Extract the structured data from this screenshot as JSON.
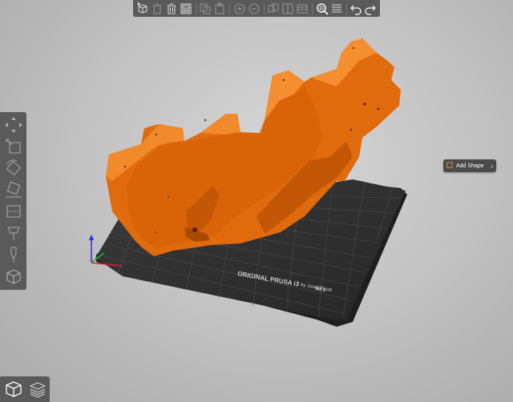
{
  "toolbar": {
    "buttons": [
      {
        "name": "add-object-icon",
        "enabled": true
      },
      {
        "name": "delete-icon",
        "enabled": false
      },
      {
        "name": "delete-all-icon",
        "enabled": true
      },
      {
        "name": "arrange-icon",
        "enabled": true
      },
      {
        "name": "copy-icon",
        "enabled": false
      },
      {
        "name": "paste-icon",
        "enabled": false
      },
      {
        "name": "add-instance-icon",
        "enabled": false
      },
      {
        "name": "remove-instance-icon",
        "enabled": false
      },
      {
        "name": "split-objects-icon",
        "enabled": false
      },
      {
        "name": "split-parts-icon",
        "enabled": false
      },
      {
        "name": "layer-editing-icon",
        "enabled": true
      },
      {
        "name": "search-icon",
        "enabled": true
      },
      {
        "name": "variable-layer-height-icon",
        "enabled": true
      },
      {
        "name": "undo-icon",
        "enabled": true
      },
      {
        "name": "redo-icon",
        "enabled": true
      }
    ]
  },
  "left_toolbar": {
    "tools": [
      "move-icon",
      "scale-icon",
      "rotate-icon",
      "place-on-face-icon",
      "cut-icon",
      "support-paint-icon",
      "seam-paint-icon",
      "fdm-support-icon"
    ]
  },
  "view_toggle": {
    "items": [
      "3d-view-icon",
      "preview-layers-icon"
    ],
    "active": "3d-view-icon"
  },
  "add_shape": {
    "label": "Add Shape",
    "icon": "shape-icon",
    "chevron": "›"
  },
  "bed": {
    "label_line1": "ORIGINAL PRUSA i3",
    "label_model": "MK3",
    "label_line2": "by Josef Prusa"
  },
  "colors": {
    "model": "#e06b0c",
    "bed": "#2e2e2e",
    "grid": "#5a5a5a",
    "toolbar": "#5a5a5a"
  }
}
